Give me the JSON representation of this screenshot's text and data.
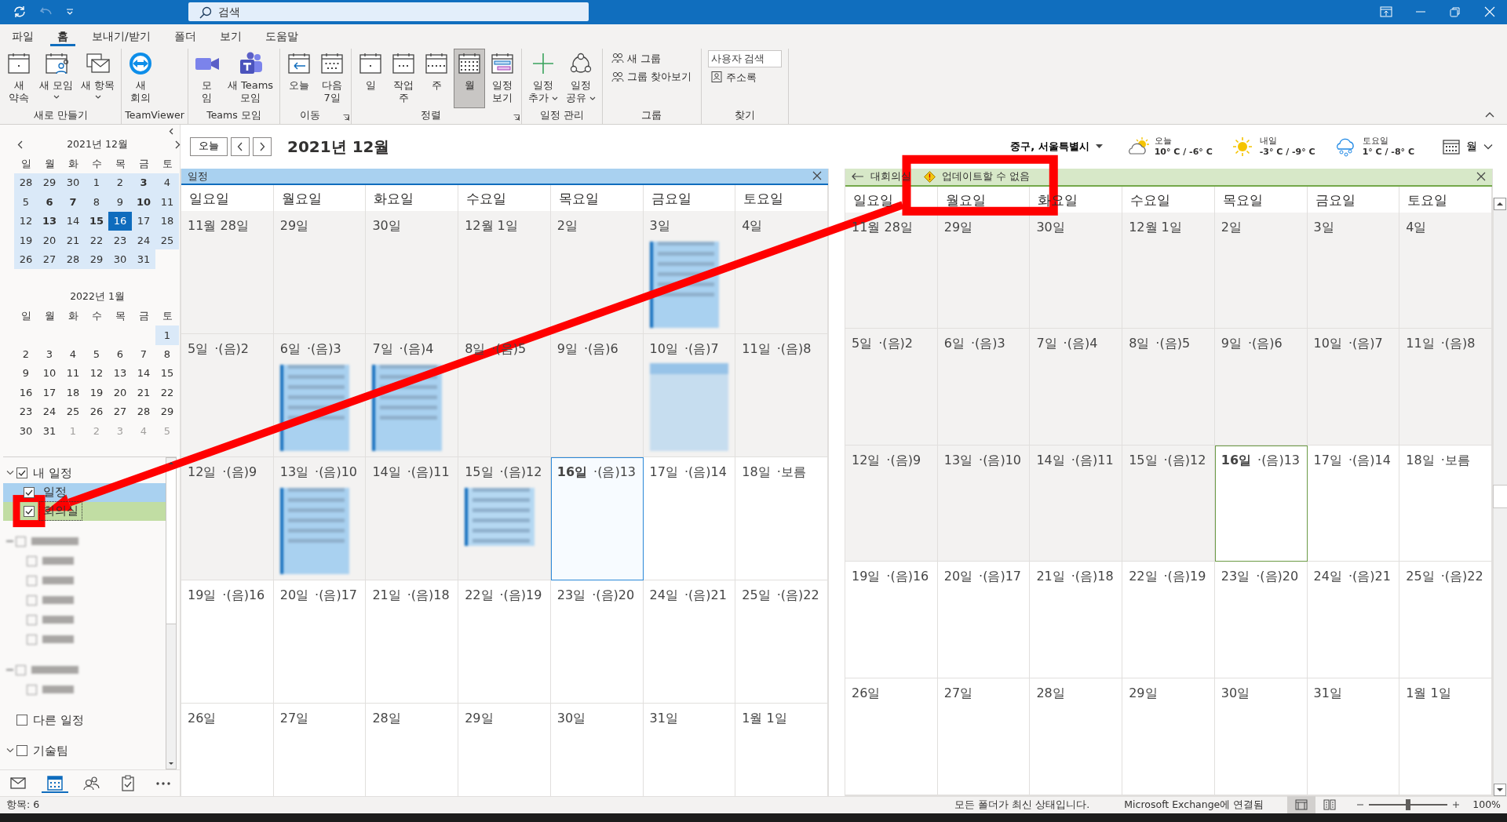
{
  "search": {
    "placeholder": "검색"
  },
  "menu_tabs": [
    {
      "label": "파일",
      "selected": false
    },
    {
      "label": "홈",
      "selected": true
    },
    {
      "label": "보내기/받기",
      "selected": false
    },
    {
      "label": "폴더",
      "selected": false
    },
    {
      "label": "보기",
      "selected": false
    },
    {
      "label": "도움말",
      "selected": false
    }
  ],
  "ribbon_groups": [
    {
      "label": "새로 만들기",
      "launcher": false,
      "buttons": [
        {
          "kind": "large",
          "lines": [
            "새",
            "약속"
          ],
          "dropdown": false,
          "selected": false
        },
        {
          "kind": "large",
          "lines": [
            "새 모임"
          ],
          "dropdown": true,
          "selected": false
        },
        {
          "kind": "large",
          "lines": [
            "새 항목"
          ],
          "dropdown": true,
          "selected": false
        }
      ]
    },
    {
      "label": "TeamViewer",
      "launcher": false,
      "buttons": [
        {
          "kind": "large",
          "lines": [
            "새",
            "회의"
          ],
          "dropdown": false,
          "selected": false
        }
      ]
    },
    {
      "label": "Teams 모임",
      "launcher": false,
      "buttons": [
        {
          "kind": "large",
          "lines": [
            "모",
            "임"
          ],
          "dropdown": false,
          "selected": false
        },
        {
          "kind": "large",
          "lines": [
            "새 Teams",
            "모임"
          ],
          "dropdown": false,
          "selected": false
        }
      ]
    },
    {
      "label": "이동",
      "launcher": true,
      "buttons": [
        {
          "kind": "large",
          "lines": [
            "오늘"
          ],
          "dropdown": false,
          "selected": false
        },
        {
          "kind": "large",
          "lines": [
            "다음",
            "7일"
          ],
          "dropdown": false,
          "selected": false
        }
      ]
    },
    {
      "label": "정렬",
      "launcher": true,
      "buttons": [
        {
          "kind": "large",
          "lines": [
            "일"
          ],
          "dropdown": false,
          "selected": false
        },
        {
          "kind": "large",
          "lines": [
            "작업",
            "주"
          ],
          "dropdown": false,
          "selected": false
        },
        {
          "kind": "large",
          "lines": [
            "주"
          ],
          "dropdown": false,
          "selected": false
        },
        {
          "kind": "large",
          "lines": [
            "월"
          ],
          "dropdown": false,
          "selected": true
        },
        {
          "kind": "large",
          "lines": [
            "일정",
            "보기"
          ],
          "dropdown": false,
          "selected": false
        }
      ]
    },
    {
      "label": "일정 관리",
      "launcher": false,
      "buttons": [
        {
          "kind": "large",
          "lines": [
            "일정",
            "추가"
          ],
          "dropdown": true,
          "selected": false
        },
        {
          "kind": "large",
          "lines": [
            "일정",
            "공유"
          ],
          "dropdown": true,
          "selected": false
        }
      ]
    },
    {
      "label": "그룹",
      "launcher": false,
      "buttons": [
        {
          "kind": "small",
          "lines": [
            "새 그룹"
          ],
          "dropdown": false,
          "selected": false
        },
        {
          "kind": "small",
          "lines": [
            "그룹 찾아보기"
          ],
          "dropdown": false,
          "selected": false
        }
      ]
    },
    {
      "label": "찾기",
      "launcher": false,
      "buttons": [
        {
          "kind": "field",
          "placeholder": "사용자 검색"
        },
        {
          "kind": "small",
          "lines": [
            "주소록"
          ],
          "dropdown": false,
          "selected": false
        }
      ]
    }
  ],
  "mini_calendars": [
    {
      "title": "2021년 12월",
      "navigation": true,
      "weekdays": [
        "일",
        "월",
        "화",
        "수",
        "목",
        "금",
        "토"
      ],
      "weeks": [
        [
          {
            "day": "28",
            "highlighted": true,
            "bold": false,
            "selected": false,
            "muted": false
          },
          {
            "day": "29",
            "highlighted": true,
            "bold": false,
            "selected": false,
            "muted": false
          },
          {
            "day": "30",
            "highlighted": true,
            "bold": false,
            "selected": false,
            "muted": false
          },
          {
            "day": "1",
            "highlighted": true,
            "bold": false,
            "selected": false,
            "muted": false
          },
          {
            "day": "2",
            "highlighted": true,
            "bold": false,
            "selected": false,
            "muted": false
          },
          {
            "day": "3",
            "highlighted": true,
            "bold": true,
            "selected": false,
            "muted": false
          },
          {
            "day": "4",
            "highlighted": true,
            "bold": false,
            "selected": false,
            "muted": false
          }
        ],
        [
          {
            "day": "5",
            "highlighted": true,
            "bold": false,
            "selected": false,
            "muted": false
          },
          {
            "day": "6",
            "highlighted": true,
            "bold": true,
            "selected": false,
            "muted": false
          },
          {
            "day": "7",
            "highlighted": true,
            "bold": true,
            "selected": false,
            "muted": false
          },
          {
            "day": "8",
            "highlighted": true,
            "bold": false,
            "selected": false,
            "muted": false
          },
          {
            "day": "9",
            "highlighted": true,
            "bold": false,
            "selected": false,
            "muted": false
          },
          {
            "day": "10",
            "highlighted": true,
            "bold": true,
            "selected": false,
            "muted": false
          },
          {
            "day": "11",
            "highlighted": true,
            "bold": false,
            "selected": false,
            "muted": false
          }
        ],
        [
          {
            "day": "12",
            "highlighted": true,
            "bold": false,
            "selected": false,
            "muted": false
          },
          {
            "day": "13",
            "highlighted": true,
            "bold": true,
            "selected": false,
            "muted": false
          },
          {
            "day": "14",
            "highlighted": true,
            "bold": false,
            "selected": false,
            "muted": false
          },
          {
            "day": "15",
            "highlighted": true,
            "bold": true,
            "selected": false,
            "muted": false
          },
          {
            "day": "16",
            "highlighted": true,
            "bold": false,
            "selected": true,
            "muted": false
          },
          {
            "day": "17",
            "highlighted": true,
            "bold": false,
            "selected": false,
            "muted": false
          },
          {
            "day": "18",
            "highlighted": true,
            "bold": false,
            "selected": false,
            "muted": false
          }
        ],
        [
          {
            "day": "19",
            "highlighted": true,
            "bold": false,
            "selected": false,
            "muted": false
          },
          {
            "day": "20",
            "highlighted": true,
            "bold": false,
            "selected": false,
            "muted": false
          },
          {
            "day": "21",
            "highlighted": true,
            "bold": false,
            "selected": false,
            "muted": false
          },
          {
            "day": "22",
            "highlighted": true,
            "bold": false,
            "selected": false,
            "muted": false
          },
          {
            "day": "23",
            "highlighted": true,
            "bold": false,
            "selected": false,
            "muted": false
          },
          {
            "day": "24",
            "highlighted": true,
            "bold": false,
            "selected": false,
            "muted": false
          },
          {
            "day": "25",
            "highlighted": true,
            "bold": false,
            "selected": false,
            "muted": false
          }
        ],
        [
          {
            "day": "26",
            "highlighted": true,
            "bold": false,
            "selected": false,
            "muted": false
          },
          {
            "day": "27",
            "highlighted": true,
            "bold": false,
            "selected": false,
            "muted": false
          },
          {
            "day": "28",
            "highlighted": true,
            "bold": false,
            "selected": false,
            "muted": false
          },
          {
            "day": "29",
            "highlighted": true,
            "bold": false,
            "selected": false,
            "muted": false
          },
          {
            "day": "30",
            "highlighted": true,
            "bold": false,
            "selected": false,
            "muted": false
          },
          {
            "day": "31",
            "highlighted": true,
            "bold": false,
            "selected": false,
            "muted": false
          }
        ]
      ]
    },
    {
      "title": "2022년 1월",
      "navigation": false,
      "weekdays": [
        "일",
        "월",
        "화",
        "수",
        "목",
        "금",
        "토"
      ],
      "weeks": [
        [
          {
            "day": "1",
            "highlighted": true,
            "bold": false,
            "selected": false,
            "muted": false
          }
        ],
        [
          {
            "day": "2",
            "highlighted": false,
            "bold": false,
            "selected": false,
            "muted": false
          },
          {
            "day": "3",
            "highlighted": false,
            "bold": false,
            "selected": false,
            "muted": false
          },
          {
            "day": "4",
            "highlighted": false,
            "bold": false,
            "selected": false,
            "muted": false
          },
          {
            "day": "5",
            "highlighted": false,
            "bold": false,
            "selected": false,
            "muted": false
          },
          {
            "day": "6",
            "highlighted": false,
            "bold": false,
            "selected": false,
            "muted": false
          },
          {
            "day": "7",
            "highlighted": false,
            "bold": false,
            "selected": false,
            "muted": false
          },
          {
            "day": "8",
            "highlighted": false,
            "bold": false,
            "selected": false,
            "muted": false
          }
        ],
        [
          {
            "day": "9",
            "highlighted": false,
            "bold": false,
            "selected": false,
            "muted": false
          },
          {
            "day": "10",
            "highlighted": false,
            "bold": false,
            "selected": false,
            "muted": false
          },
          {
            "day": "11",
            "highlighted": false,
            "bold": false,
            "selected": false,
            "muted": false
          },
          {
            "day": "12",
            "highlighted": false,
            "bold": false,
            "selected": false,
            "muted": false
          },
          {
            "day": "13",
            "highlighted": false,
            "bold": false,
            "selected": false,
            "muted": false
          },
          {
            "day": "14",
            "highlighted": false,
            "bold": false,
            "selected": false,
            "muted": false
          },
          {
            "day": "15",
            "highlighted": false,
            "bold": false,
            "selected": false,
            "muted": false
          }
        ],
        [
          {
            "day": "16",
            "highlighted": false,
            "bold": false,
            "selected": false,
            "muted": false
          },
          {
            "day": "17",
            "highlighted": false,
            "bold": false,
            "selected": false,
            "muted": false
          },
          {
            "day": "18",
            "highlighted": false,
            "bold": false,
            "selected": false,
            "muted": false
          },
          {
            "day": "19",
            "highlighted": false,
            "bold": false,
            "selected": false,
            "muted": false
          },
          {
            "day": "20",
            "highlighted": false,
            "bold": false,
            "selected": false,
            "muted": false
          },
          {
            "day": "21",
            "highlighted": false,
            "bold": false,
            "selected": false,
            "muted": false
          },
          {
            "day": "22",
            "highlighted": false,
            "bold": false,
            "selected": false,
            "muted": false
          }
        ],
        [
          {
            "day": "23",
            "highlighted": false,
            "bold": false,
            "selected": false,
            "muted": false
          },
          {
            "day": "24",
            "highlighted": false,
            "bold": false,
            "selected": false,
            "muted": false
          },
          {
            "day": "25",
            "highlighted": false,
            "bold": false,
            "selected": false,
            "muted": false
          },
          {
            "day": "26",
            "highlighted": false,
            "bold": false,
            "selected": false,
            "muted": false
          },
          {
            "day": "27",
            "highlighted": false,
            "bold": false,
            "selected": false,
            "muted": false
          },
          {
            "day": "28",
            "highlighted": false,
            "bold": false,
            "selected": false,
            "muted": false
          },
          {
            "day": "29",
            "highlighted": false,
            "bold": false,
            "selected": false,
            "muted": false
          }
        ],
        [
          {
            "day": "30",
            "highlighted": false,
            "bold": false,
            "selected": false,
            "muted": false
          },
          {
            "day": "31",
            "highlighted": false,
            "bold": false,
            "selected": false,
            "muted": false
          },
          {
            "day": "1",
            "highlighted": false,
            "bold": false,
            "selected": false,
            "muted": true
          },
          {
            "day": "2",
            "highlighted": false,
            "bold": false,
            "selected": false,
            "muted": true
          },
          {
            "day": "3",
            "highlighted": false,
            "bold": false,
            "selected": false,
            "muted": true
          },
          {
            "day": "4",
            "highlighted": false,
            "bold": false,
            "selected": false,
            "muted": true
          },
          {
            "day": "5",
            "highlighted": false,
            "bold": false,
            "selected": false,
            "muted": true
          }
        ]
      ]
    }
  ],
  "calendar_folders": [
    {
      "kind": "group",
      "label": "내 일정",
      "checked": true,
      "expanded": true,
      "children": [
        {
          "kind": "calendar",
          "label": "일정",
          "checked": true,
          "focused": false,
          "color": "#a9d1f0"
        },
        {
          "kind": "calendar",
          "label": "회의실",
          "checked": true,
          "focused": true,
          "color": "#c1dda3"
        }
      ]
    },
    {
      "kind": "redacted",
      "checked": false,
      "expanded": true,
      "children": [
        {
          "kind": "redacted",
          "checked": false
        },
        {
          "kind": "redacted",
          "checked": false
        },
        {
          "kind": "redacted",
          "checked": false
        },
        {
          "kind": "redacted",
          "checked": false
        },
        {
          "kind": "redacted",
          "checked": false
        }
      ]
    },
    {
      "kind": "redacted",
      "checked": false,
      "expanded": true,
      "children": [
        {
          "kind": "redacted",
          "checked": false
        }
      ]
    },
    {
      "kind": "group",
      "label": "다른 일정",
      "checked": false,
      "expanded": false
    },
    {
      "kind": "group",
      "label": "기술팀",
      "checked": false,
      "expanded": true
    }
  ],
  "nav_items": [
    {
      "selected": false
    },
    {
      "selected": true
    },
    {
      "selected": false
    },
    {
      "selected": false
    },
    {
      "selected": false
    }
  ],
  "header": {
    "today_button": "오늘",
    "title": "2021년 12월",
    "location": "중구, 서울특별시",
    "weather": [
      {
        "day": "오늘",
        "temps": "10° C / -6° C"
      },
      {
        "day": "내일",
        "temps": "-3° C / -9° C"
      },
      {
        "day": "토요일",
        "temps": "1° C / -8° C"
      }
    ],
    "view": "월"
  },
  "calendars": [
    {
      "title": "일정",
      "color": "#a9d1f0",
      "back": false,
      "weekdays": [
        "일요일",
        "월요일",
        "화요일",
        "수요일",
        "목요일",
        "금요일",
        "토요일"
      ],
      "weeks": [
        [
          {
            "date": "11월 28일",
            "past": true,
            "today": false
          },
          {
            "date": "29일",
            "past": true,
            "today": false
          },
          {
            "date": "30일",
            "past": true,
            "today": false
          },
          {
            "date": "12월 1일",
            "past": true,
            "today": false
          },
          {
            "date": "2일",
            "past": true,
            "today": false
          },
          {
            "date": "3일",
            "past": true,
            "today": false,
            "events": [
              {
                "kind": "timed"
              }
            ]
          },
          {
            "date": "4일",
            "past": true,
            "today": false
          }
        ],
        [
          {
            "date": "5일",
            "lunar": "·(음)2",
            "past": true,
            "today": false
          },
          {
            "date": "6일",
            "lunar": "·(음)3",
            "past": true,
            "today": false,
            "events": [
              {
                "kind": "timed"
              }
            ]
          },
          {
            "date": "7일",
            "lunar": "·(음)4",
            "past": true,
            "today": false,
            "events": [
              {
                "kind": "timed"
              }
            ]
          },
          {
            "date": "8일",
            "lunar": "·(음)5",
            "past": true,
            "today": false
          },
          {
            "date": "9일",
            "lunar": "·(음)6",
            "past": true,
            "today": false
          },
          {
            "date": "10일",
            "lunar": "·(음)7",
            "past": true,
            "today": false,
            "events": [
              {
                "kind": "allday"
              }
            ]
          },
          {
            "date": "11일",
            "lunar": "·(음)8",
            "past": true,
            "today": false
          }
        ],
        [
          {
            "date": "12일",
            "lunar": "·(음)9",
            "past": true,
            "today": false
          },
          {
            "date": "13일",
            "lunar": "·(음)10",
            "past": true,
            "today": false,
            "events": [
              {
                "kind": "timed"
              }
            ]
          },
          {
            "date": "14일",
            "lunar": "·(음)11",
            "past": true,
            "today": false
          },
          {
            "date": "15일",
            "lunar": "·(음)12",
            "past": true,
            "today": false,
            "events": [
              {
                "kind": "short"
              }
            ]
          },
          {
            "date": "16일",
            "lunar": "·(음)13",
            "past": false,
            "today": true
          },
          {
            "date": "17일",
            "lunar": "·(음)14",
            "past": false,
            "today": false
          },
          {
            "date": "18일",
            "lunar": "·보름",
            "past": false,
            "today": false
          }
        ],
        [
          {
            "date": "19일",
            "lunar": "·(음)16",
            "past": false,
            "today": false
          },
          {
            "date": "20일",
            "lunar": "·(음)17",
            "past": false,
            "today": false
          },
          {
            "date": "21일",
            "lunar": "·(음)18",
            "past": false,
            "today": false
          },
          {
            "date": "22일",
            "lunar": "·(음)19",
            "past": false,
            "today": false
          },
          {
            "date": "23일",
            "lunar": "·(음)20",
            "past": false,
            "today": false
          },
          {
            "date": "24일",
            "lunar": "·(음)21",
            "past": false,
            "today": false
          },
          {
            "date": "25일",
            "lunar": "·(음)22",
            "past": false,
            "today": false
          }
        ],
        [
          {
            "date": "26일",
            "past": false,
            "today": false
          },
          {
            "date": "27일",
            "past": false,
            "today": false
          },
          {
            "date": "28일",
            "past": false,
            "today": false
          },
          {
            "date": "29일",
            "past": false,
            "today": false
          },
          {
            "date": "30일",
            "past": false,
            "today": false
          },
          {
            "date": "31일",
            "past": false,
            "today": false
          },
          {
            "date": "1월 1일",
            "past": false,
            "today": false
          }
        ]
      ]
    },
    {
      "title": "대회의실",
      "color": "#d7e8c8",
      "status": "업데이트할 수 없음",
      "back": true,
      "weekdays": [
        "일요일",
        "월요일",
        "화요일",
        "수요일",
        "목요일",
        "금요일",
        "토요일"
      ],
      "weeks": [
        [
          {
            "date": "11월 28일",
            "past": true,
            "today": false
          },
          {
            "date": "29일",
            "past": true,
            "today": false
          },
          {
            "date": "30일",
            "past": true,
            "today": false
          },
          {
            "date": "12월 1일",
            "past": true,
            "today": false
          },
          {
            "date": "2일",
            "past": true,
            "today": false
          },
          {
            "date": "3일",
            "past": true,
            "today": false
          },
          {
            "date": "4일",
            "past": true,
            "today": false
          }
        ],
        [
          {
            "date": "5일",
            "lunar": "·(음)2",
            "past": true,
            "today": false
          },
          {
            "date": "6일",
            "lunar": "·(음)3",
            "past": true,
            "today": false
          },
          {
            "date": "7일",
            "lunar": "·(음)4",
            "past": true,
            "today": false
          },
          {
            "date": "8일",
            "lunar": "·(음)5",
            "past": true,
            "today": false
          },
          {
            "date": "9일",
            "lunar": "·(음)6",
            "past": true,
            "today": false
          },
          {
            "date": "10일",
            "lunar": "·(음)7",
            "past": true,
            "today": false
          },
          {
            "date": "11일",
            "lunar": "·(음)8",
            "past": true,
            "today": false
          }
        ],
        [
          {
            "date": "12일",
            "lunar": "·(음)9",
            "past": true,
            "today": false
          },
          {
            "date": "13일",
            "lunar": "·(음)10",
            "past": true,
            "today": false
          },
          {
            "date": "14일",
            "lunar": "·(음)11",
            "past": true,
            "today": false
          },
          {
            "date": "15일",
            "lunar": "·(음)12",
            "past": true,
            "today": false
          },
          {
            "date": "16일",
            "lunar": "·(음)13",
            "past": false,
            "today": true
          },
          {
            "date": "17일",
            "lunar": "·(음)14",
            "past": false,
            "today": false
          },
          {
            "date": "18일",
            "lunar": "·보름",
            "past": false,
            "today": false
          }
        ],
        [
          {
            "date": "19일",
            "lunar": "·(음)16",
            "past": false,
            "today": false
          },
          {
            "date": "20일",
            "lunar": "·(음)17",
            "past": false,
            "today": false
          },
          {
            "date": "21일",
            "lunar": "·(음)18",
            "past": false,
            "today": false
          },
          {
            "date": "22일",
            "lunar": "·(음)19",
            "past": false,
            "today": false
          },
          {
            "date": "23일",
            "lunar": "·(음)20",
            "past": false,
            "today": false
          },
          {
            "date": "24일",
            "lunar": "·(음)21",
            "past": false,
            "today": false
          },
          {
            "date": "25일",
            "lunar": "·(음)22",
            "past": false,
            "today": false
          }
        ],
        [
          {
            "date": "26일",
            "past": false,
            "today": false
          },
          {
            "date": "27일",
            "past": false,
            "today": false
          },
          {
            "date": "28일",
            "past": false,
            "today": false
          },
          {
            "date": "29일",
            "past": false,
            "today": false
          },
          {
            "date": "30일",
            "past": false,
            "today": false
          },
          {
            "date": "31일",
            "past": false,
            "today": false
          },
          {
            "date": "1월 1일",
            "past": false,
            "today": false
          }
        ]
      ]
    }
  ],
  "status_bar": {
    "items": "항목: 6",
    "sync": "모든 폴더가 최신 상태입니다.",
    "connection": "Microsoft Exchange에 연결됨",
    "views": [
      {
        "selected": true
      },
      {
        "selected": false
      }
    ],
    "zoom": {
      "level": 0.5,
      "reading": "100%"
    }
  }
}
